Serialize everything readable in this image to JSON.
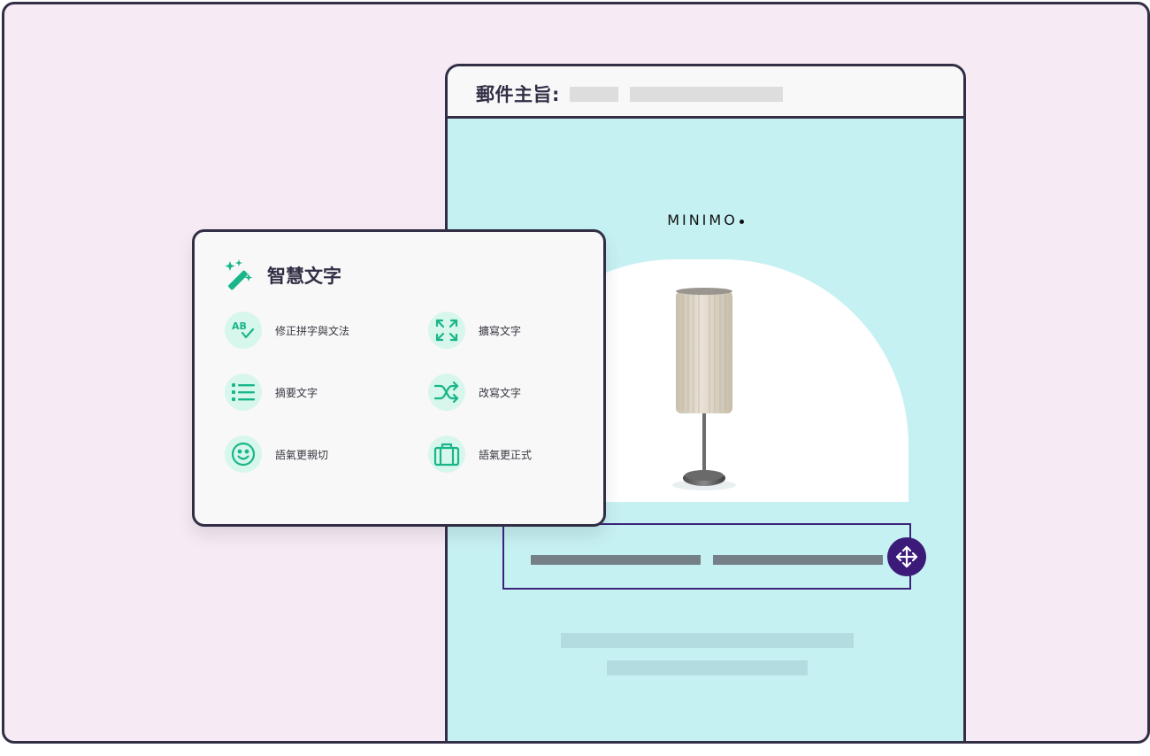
{
  "email": {
    "subject_label": "郵件主旨:",
    "brand": "MINIMO"
  },
  "smart_panel": {
    "title": "智慧文字",
    "options": [
      {
        "label": "修正拼字與文法",
        "icon": "ab-check-icon"
      },
      {
        "label": "擴寫文字",
        "icon": "expand-arrows-icon"
      },
      {
        "label": "摘要文字",
        "icon": "list-icon"
      },
      {
        "label": "改寫文字",
        "icon": "shuffle-icon"
      },
      {
        "label": "語氣更親切",
        "icon": "smile-icon"
      },
      {
        "label": "語氣更正式",
        "icon": "briefcase-icon"
      }
    ]
  },
  "colors": {
    "accent": "#19b689",
    "dark": "#322e45",
    "handle": "#3b1a7a",
    "email_bg": "#c6f1f3",
    "page_bg": "#f6ebf5"
  }
}
